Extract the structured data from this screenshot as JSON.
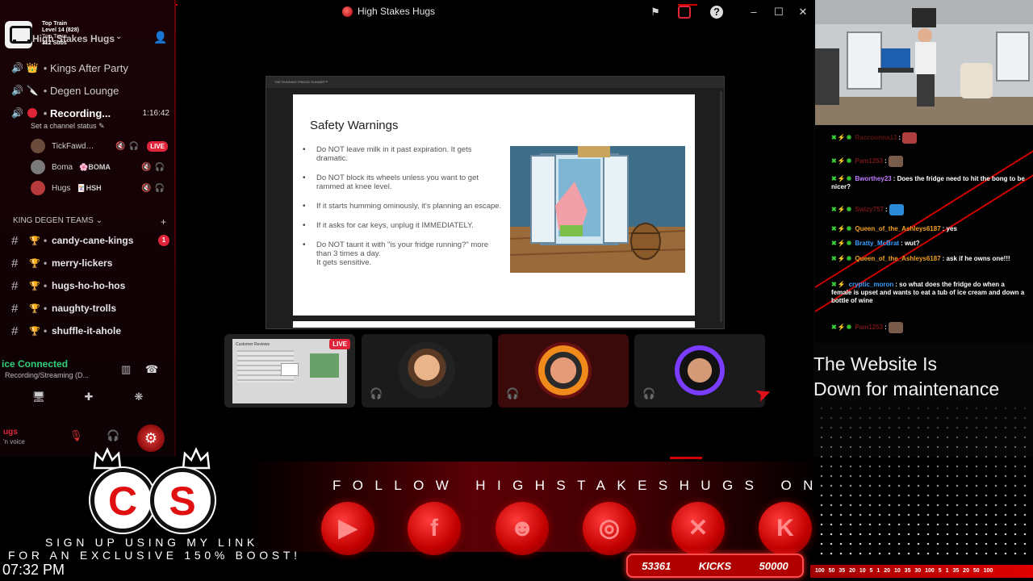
{
  "window": {
    "title": "High Stakes Hugs"
  },
  "server": {
    "name": "High Stakes Hugs",
    "stats": [
      "Top Train",
      "Level 14 (828)",
      "Top Train",
      "312 Subs"
    ]
  },
  "voice_channels": [
    {
      "emoji": "👑",
      "name": "Kings After Party"
    },
    {
      "emoji": "🔪",
      "name": "Degen Lounge"
    },
    {
      "name": "Recording...",
      "timer": "1:16:42"
    }
  ],
  "channel_status": "Set a channel status",
  "members": [
    {
      "name": "TickFawd…",
      "badge": "LIVE"
    },
    {
      "name": "Boma",
      "tag": "BOMA"
    },
    {
      "name": "Hugs",
      "tag": "HSH"
    }
  ],
  "category": "KING DEGEN TEAMS",
  "text_channels": [
    {
      "name": "candy-cane-kings",
      "badge": "1"
    },
    {
      "name": "merry-lickers"
    },
    {
      "name": "hugs-ho-ho-hos"
    },
    {
      "name": "naughty-trolls"
    },
    {
      "name": "shuffle-it-ahole"
    }
  ],
  "voice_connection": {
    "status": "ice Connected",
    "detail": "Recording/Streaming (D..."
  },
  "user": {
    "name": "ugs",
    "status": "'n voice"
  },
  "slide": {
    "toolbar": "THE RUNNING FRIDGE RUNNER™",
    "title": "Safety Warnings",
    "bullets": [
      "Do NOT leave milk in it past expiration. It gets dramatic.",
      "Do NOT block its wheels unless you want to get rammed at knee level.",
      "If it starts humming ominously, it's planning an escape.",
      "If it asks for car keys, unplug it IMMEDIATELY.",
      "Do NOT taunt it with \"is your fridge running?\" more than 3 times a day.\n It gets sensitive."
    ]
  },
  "stream_tile": {
    "live_label": "LIVE",
    "preview_title": "Customer Reviews"
  },
  "chat": [
    {
      "user": "Raccoonna13",
      "text": "",
      "color": "#e02a2a"
    },
    {
      "user": "Pam1253",
      "text": "",
      "color": "#e02a2a"
    },
    {
      "user": "Bworthey23",
      "text": "Does the fridge need to hit the bong to be nicer?",
      "color": "#c27cff"
    },
    {
      "user": "Swizy757",
      "text": "",
      "color": "#e02a2a"
    },
    {
      "user": "Queen_of_the_Ashleys6187",
      "text": "yes",
      "color": "#f0a020"
    },
    {
      "user": "Bratty_McBrat",
      "text": "wut?",
      "color": "#3aa0ff"
    },
    {
      "user": "Queen_of_the_Ashleys6187",
      "text": "ask if he owns one!!!",
      "color": "#f0a020"
    },
    {
      "user": "cryptic_moron",
      "text": "so what does the fridge do when a female is upset and wants to eat a tub of ice cream and down a bottle of wine",
      "color": "#3aa0ff"
    },
    {
      "user": "Pam1253",
      "text": "",
      "color": "#e02a2a"
    }
  ],
  "maintenance": [
    "The Website Is",
    "Down for maintenance"
  ],
  "follow_text": "FOLLOW HIGHSTAKESHUGS ON",
  "socials": [
    "youtube-icon",
    "facebook-icon",
    "discord-icon",
    "instagram-icon",
    "x-icon",
    "kick-icon"
  ],
  "promo": {
    "letters": [
      "C",
      "S"
    ],
    "line1": "SIGN UP USING MY LINK",
    "line2": "FOR AN EXCLUSIVE 150% BOOST!"
  },
  "clock": "07:32 PM",
  "kicks": {
    "current": "53361",
    "label": "KICKS",
    "goal": "50000"
  },
  "ticker": "100 50 35 20 10 5 1 20 10 35 30 100 5 1 35 20 50 100",
  "colors": {
    "accent": "#e0243a",
    "brand_red": "#d30000",
    "connected": "#2fd07a"
  }
}
